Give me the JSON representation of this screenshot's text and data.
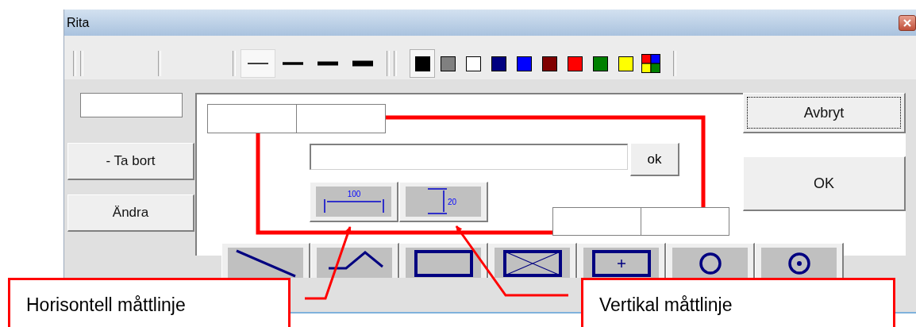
{
  "window": {
    "title": "Rita"
  },
  "toolbar": {
    "line_widths": [
      {
        "kind": "thin",
        "selected": true
      },
      {
        "kind": "medium",
        "selected": false
      },
      {
        "kind": "thick",
        "selected": false
      },
      {
        "kind": "heavy",
        "selected": false
      }
    ],
    "colors": [
      {
        "kind": "swatch",
        "color": "#000000",
        "selected": true
      },
      {
        "kind": "swatch",
        "color": "#808080",
        "selected": false
      },
      {
        "kind": "swatch",
        "color": "#ffffff",
        "selected": false
      },
      {
        "kind": "swatch",
        "color": "#000080",
        "selected": false
      },
      {
        "kind": "swatch",
        "color": "#0000ff",
        "selected": false
      },
      {
        "kind": "swatch",
        "color": "#800000",
        "selected": false
      },
      {
        "kind": "swatch",
        "color": "#ff0000",
        "selected": false
      },
      {
        "kind": "swatch",
        "color": "#008000",
        "selected": false
      },
      {
        "kind": "swatch",
        "color": "#ffff00",
        "selected": false
      },
      {
        "kind": "palette",
        "selected": false
      }
    ]
  },
  "side_buttons": [
    "- Ta bort",
    "Ändra"
  ],
  "ok_small": "ok",
  "dimension_buttons": [
    {
      "kind": "horizontal",
      "value": "100"
    },
    {
      "kind": "vertical",
      "value": "20"
    }
  ],
  "dialog_buttons": [
    {
      "label": "Avbryt",
      "focused": true
    },
    {
      "label": "OK",
      "focused": false
    }
  ],
  "shape_buttons": [
    {
      "kind": "line"
    },
    {
      "kind": "polyline"
    },
    {
      "kind": "rectangle"
    },
    {
      "kind": "crossed-rectangle"
    },
    {
      "kind": "centered-rectangle"
    },
    {
      "kind": "circle"
    },
    {
      "kind": "centered-circle"
    }
  ],
  "callouts": [
    {
      "text": "Horisontell måttlinje"
    },
    {
      "text": "Vertikal måttlinje"
    }
  ]
}
